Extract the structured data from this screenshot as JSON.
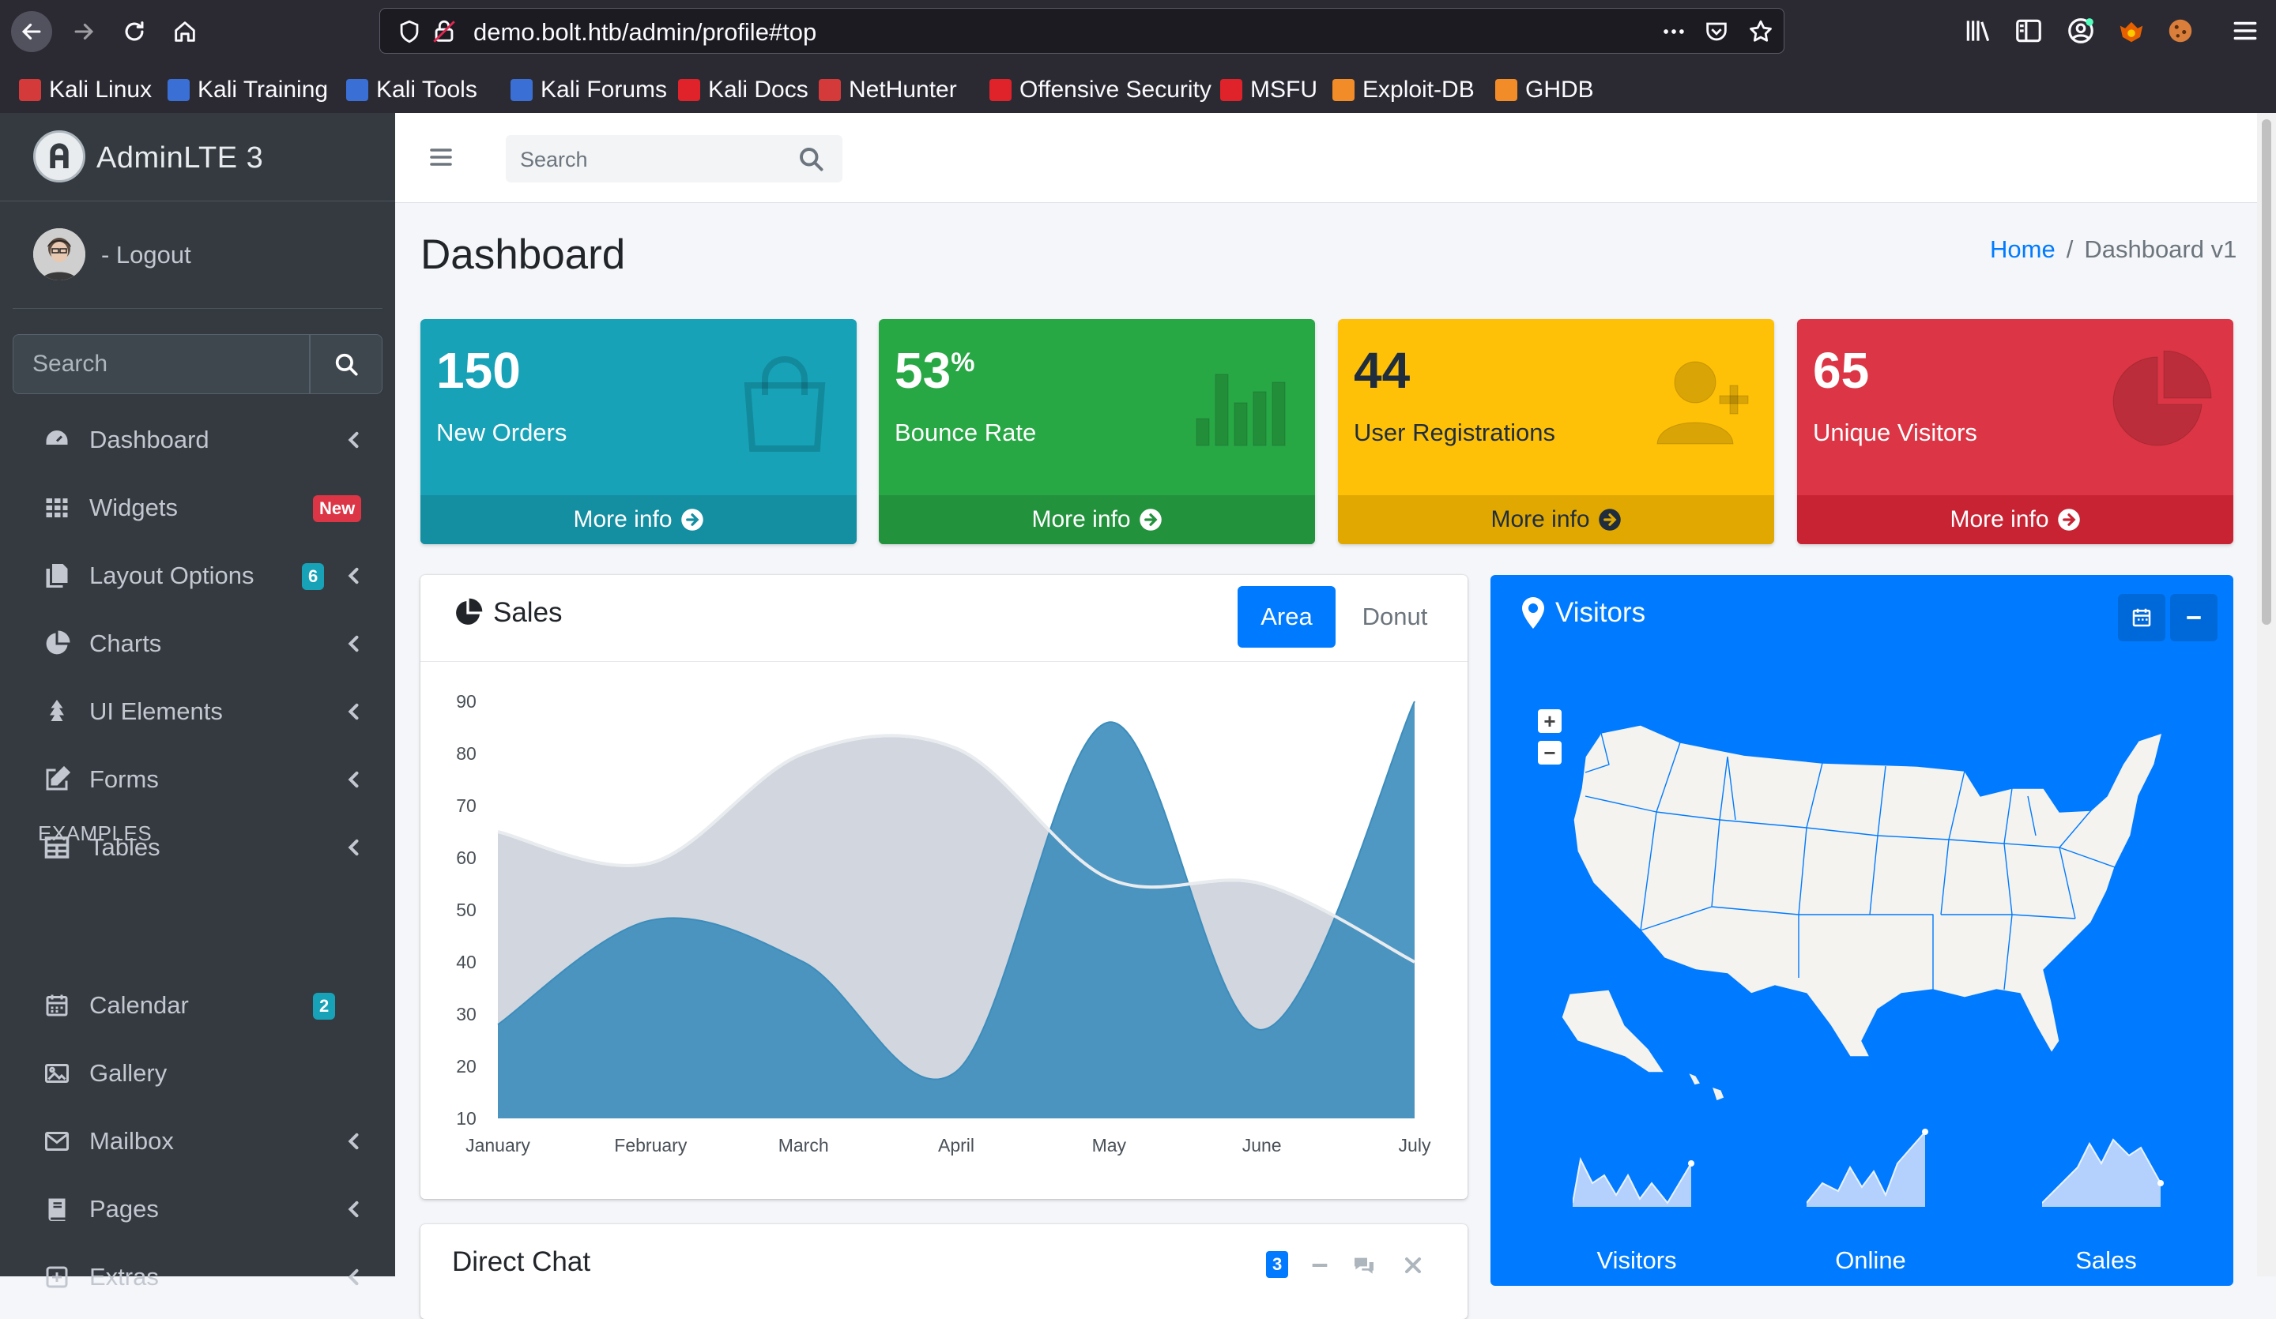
{
  "browser": {
    "url": "demo.bolt.htb/admin/profile#top",
    "bookmarks": [
      {
        "label": "Kali Linux",
        "color": "#d53a3a"
      },
      {
        "label": "Kali Training",
        "color": "#3a6fd5"
      },
      {
        "label": "Kali Tools",
        "color": "#3a6fd5"
      },
      {
        "label": "Kali Forums",
        "color": "#3a6fd5"
      },
      {
        "label": "Kali Docs",
        "color": "#e0222a"
      },
      {
        "label": "NetHunter",
        "color": "#d53a3a"
      },
      {
        "label": "Offensive Security",
        "color": "#e0222a"
      },
      {
        "label": "MSFU",
        "color": "#e0222a"
      },
      {
        "label": "Exploit-DB",
        "color": "#f28c28"
      },
      {
        "label": "GHDB",
        "color": "#f28c28"
      }
    ]
  },
  "sidebar": {
    "brand": "AdminLTE 3",
    "user": "- Logout",
    "search_placeholder": "Search",
    "section_header": "EXAMPLES",
    "items": [
      {
        "label": "Dashboard",
        "icon": "dashboard-icon",
        "chevron": true
      },
      {
        "label": "Widgets",
        "icon": "th-icon",
        "badge": "New",
        "badge_color": "#dc3545"
      },
      {
        "label": "Layout Options",
        "icon": "copy-icon",
        "badge": "6",
        "badge_color": "#17a2b8",
        "chevron": true
      },
      {
        "label": "Charts",
        "icon": "chart-pie-icon",
        "chevron": true
      },
      {
        "label": "UI Elements",
        "icon": "tree-icon",
        "chevron": true
      },
      {
        "label": "Forms",
        "icon": "edit-icon",
        "chevron": true
      },
      {
        "label": "Tables",
        "icon": "table-icon",
        "chevron": true
      },
      {
        "label": "Calendar",
        "icon": "calendar-icon",
        "badge": "2",
        "badge_color": "#17a2b8"
      },
      {
        "label": "Gallery",
        "icon": "image-icon"
      },
      {
        "label": "Mailbox",
        "icon": "envelope-icon",
        "chevron": true
      },
      {
        "label": "Pages",
        "icon": "book-icon",
        "chevron": true
      },
      {
        "label": "Extras",
        "icon": "plus-square-icon",
        "chevron": true
      }
    ]
  },
  "topnav": {
    "search_placeholder": "Search"
  },
  "header": {
    "title": "Dashboard",
    "breadcrumb_home": "Home",
    "breadcrumb_sep": "/",
    "breadcrumb_current": "Dashboard v1"
  },
  "small_boxes": [
    {
      "value": "150",
      "suffix": "",
      "label": "New Orders",
      "more": "More info",
      "color": "#17a2b8",
      "footer_color": "#148ea1",
      "text_color": "#ffffff",
      "icon": "shopping-bag-icon"
    },
    {
      "value": "53",
      "suffix": "%",
      "label": "Bounce Rate",
      "more": "More info",
      "color": "#28a745",
      "footer_color": "#23923d",
      "text_color": "#ffffff",
      "icon": "bar-chart-icon"
    },
    {
      "value": "44",
      "suffix": "",
      "label": "User Registrations",
      "more": "More info",
      "color": "#ffc107",
      "footer_color": "#e0a800",
      "text_color": "#1f2d3d",
      "icon": "user-plus-icon"
    },
    {
      "value": "65",
      "suffix": "",
      "label": "Unique Visitors",
      "more": "More info",
      "color": "#dc3545",
      "footer_color": "#c82333",
      "text_color": "#ffffff",
      "icon": "pie-chart-icon"
    }
  ],
  "sales": {
    "title": "Sales",
    "tab_area": "Area",
    "tab_donut": "Donut"
  },
  "chat": {
    "title": "Direct Chat",
    "badge": "3"
  },
  "visitors": {
    "title": "Visitors",
    "sparklines": [
      "Visitors",
      "Online",
      "Sales"
    ]
  },
  "chart_data": {
    "type": "area",
    "categories": [
      "January",
      "February",
      "March",
      "April",
      "May",
      "June",
      "July"
    ],
    "ylim": [
      10,
      90
    ],
    "yticks": [
      10,
      20,
      30,
      40,
      50,
      60,
      70,
      80,
      90
    ],
    "series": [
      {
        "values": [
          65,
          59,
          80,
          81,
          56,
          55,
          40
        ],
        "color": "#d2d6de"
      },
      {
        "values": [
          28,
          48,
          40,
          19,
          86,
          27,
          90
        ],
        "color": "#3c8dbc"
      }
    ]
  }
}
